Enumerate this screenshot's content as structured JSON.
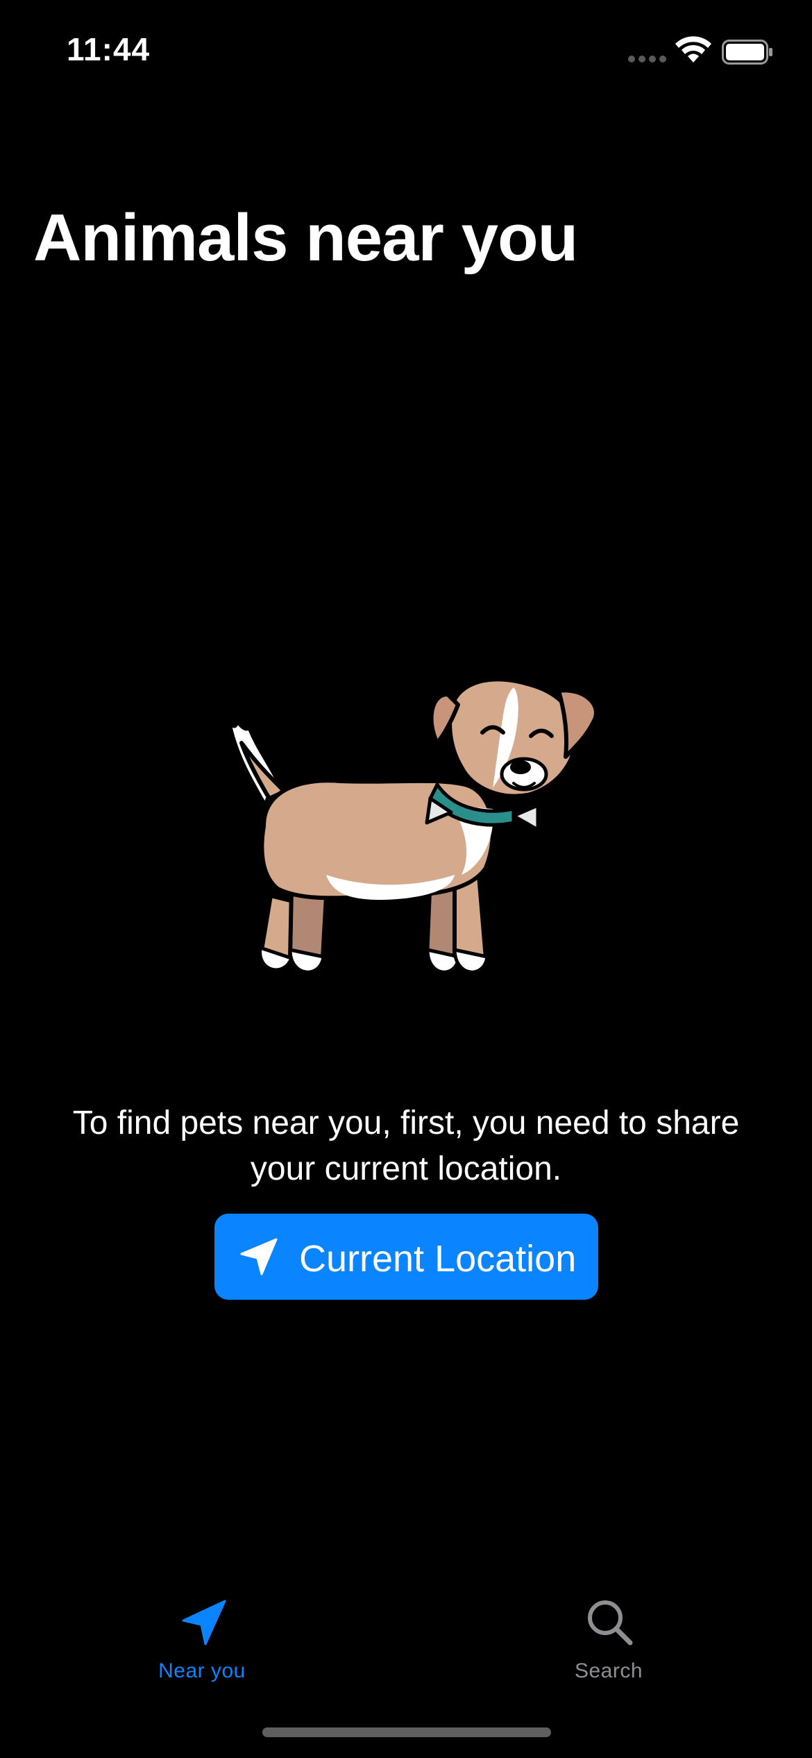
{
  "status_bar": {
    "time": "11:44"
  },
  "title": "Animals near you",
  "message": "To find pets near you, first, you need to share your current location.",
  "location_button": {
    "label": "Current Location",
    "icon": "location-arrow-icon"
  },
  "tab_bar": {
    "items": [
      {
        "label": "Near you",
        "icon": "location-arrow-icon",
        "selected": true
      },
      {
        "label": "Search",
        "icon": "magnifying-glass-icon",
        "selected": false
      }
    ]
  },
  "colors": {
    "background": "#000000",
    "accent": "#0a84ff",
    "inactive_tab": "#8e8e93",
    "text": "#ffffff"
  }
}
